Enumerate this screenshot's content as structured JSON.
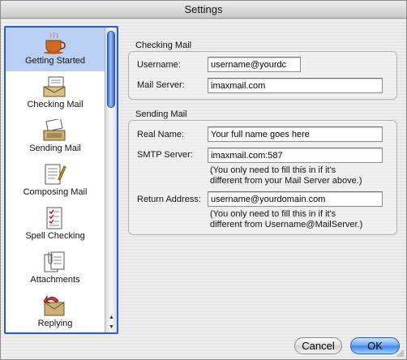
{
  "window": {
    "title": "Settings"
  },
  "sidebar": {
    "items": [
      {
        "label": "Getting Started",
        "icon": "coffee-cup-icon",
        "selected": true
      },
      {
        "label": "Checking Mail",
        "icon": "mailbox-icon",
        "selected": false
      },
      {
        "label": "Sending Mail",
        "icon": "outbox-icon",
        "selected": false
      },
      {
        "label": "Composing Mail",
        "icon": "compose-icon",
        "selected": false
      },
      {
        "label": "Spell Checking",
        "icon": "spellcheck-icon",
        "selected": false
      },
      {
        "label": "Attachments",
        "icon": "paperclip-icon",
        "selected": false
      },
      {
        "label": "Replying",
        "icon": "reply-icon",
        "selected": false
      }
    ]
  },
  "checking_mail": {
    "title": "Checking Mail",
    "username_label": "Username:",
    "username_value": "username@yourdc",
    "server_label": "Mail Server:",
    "server_value": "imaxmail.com"
  },
  "sending_mail": {
    "title": "Sending Mail",
    "realname_label": "Real Name:",
    "realname_value": "Your full name goes here",
    "smtp_label": "SMTP Server:",
    "smtp_value": "imaxmail.com:587",
    "smtp_hint_line1": "(You only need to fill this in if it's",
    "smtp_hint_line2": "different from your Mail Server above.)",
    "return_label": "Return Address:",
    "return_value": "username@yourdomain.com",
    "return_hint_line1": "(You only need to fill this in if it's",
    "return_hint_line2": "different from Username@MailServer.)"
  },
  "buttons": {
    "cancel": "Cancel",
    "ok": "OK"
  },
  "colors": {
    "selection": "#b9d0f4",
    "sidebar_border": "#2a5ad6",
    "ok_button": "#3b82e6"
  }
}
